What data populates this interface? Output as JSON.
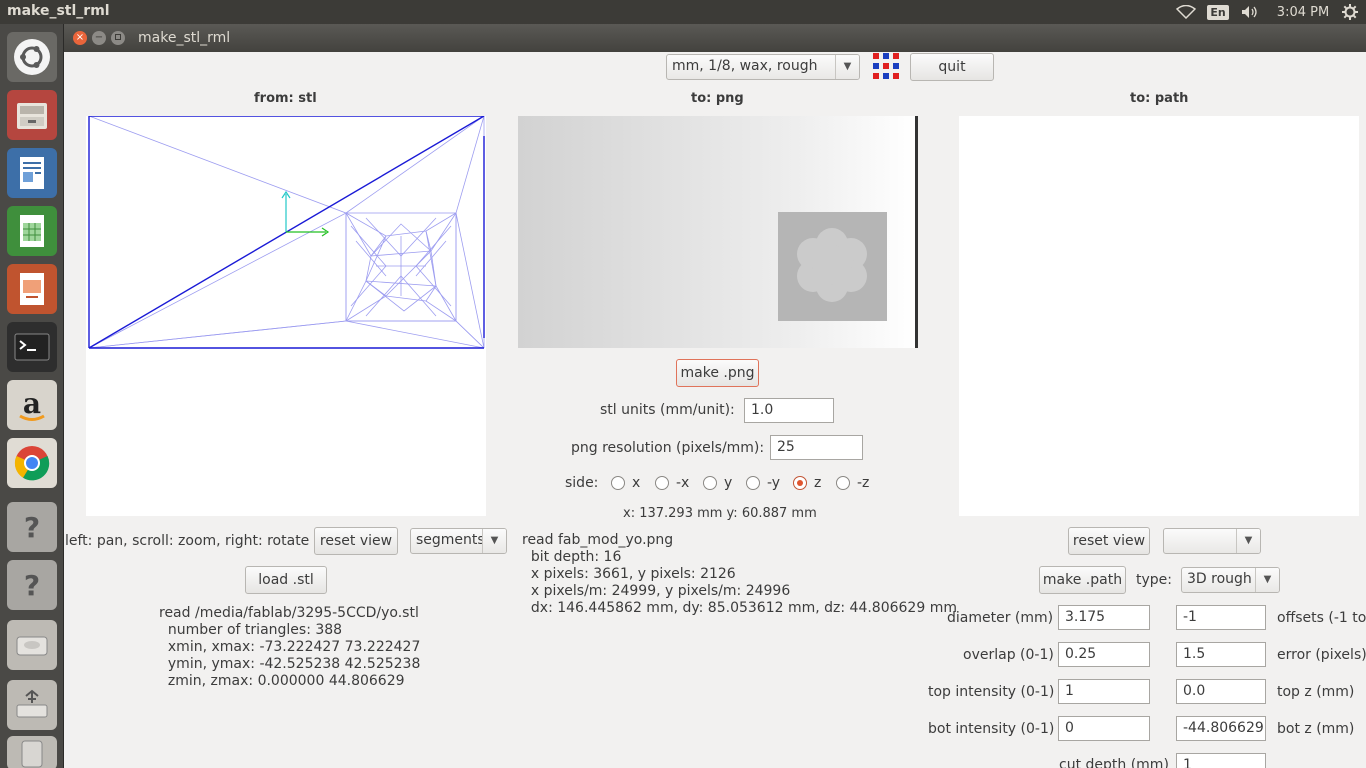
{
  "topbar": {
    "title": "make_stl_rml",
    "keyboard": "En",
    "clock": "3:04 PM"
  },
  "window": {
    "title": "make_stl_rml",
    "close_glyph": "×",
    "min_glyph": "−"
  },
  "toolbar": {
    "machine_select": "mm, 1/8, wax, rough",
    "quit_label": "quit"
  },
  "panels": {
    "from_stl": "from: stl",
    "to_png": "to: png",
    "to_path": "to: path"
  },
  "stl_section": {
    "hint": "left: pan, scroll: zoom, right: rotate",
    "reset_view_label": "reset view",
    "view_mode": "segments",
    "load_label": "load .stl",
    "info": {
      "line1": "read /media/fablab/3295-5CCD/yo.stl",
      "line2": "  number of triangles: 388",
      "line3": "  xmin, xmax: -73.222427 73.222427",
      "line4": "  ymin, ymax: -42.525238 42.525238",
      "line5": "  zmin, zmax: 0.000000 44.806629"
    }
  },
  "png_section": {
    "make_label": "make .png",
    "units_label": "stl units (mm/unit):",
    "units_value": "1.0",
    "resolution_label": "png resolution (pixels/mm):",
    "resolution_value": "25",
    "side_label": "side:",
    "sides": [
      "x",
      "-x",
      "y",
      "-y",
      "z",
      "-z"
    ],
    "selected_side": "z",
    "coords": "x: 137.293 mm  y: 60.887 mm",
    "info": {
      "line1": "read fab_mod_yo.png",
      "line2": "  bit depth: 16",
      "line3": "  x pixels: 3661, y pixels: 2126",
      "line4": "  x pixels/m: 24999, y pixels/m: 24996",
      "line5": "  dx: 146.445862 mm, dy: 85.053612 mm, dz: 44.806629 mm"
    }
  },
  "path_section": {
    "reset_view_label": "reset view",
    "view_mode": "",
    "make_label": "make .path",
    "type_label": "type:",
    "type_value": "3D rough",
    "diameter_label": "diameter (mm)",
    "diameter_value": "3.175",
    "offsets_value": "-1",
    "offsets_label": "offsets (-1 to",
    "overlap_label": "overlap (0-1)",
    "overlap_value": "0.25",
    "error_value": "1.5",
    "error_label": "error (pixels)",
    "top_intensity_label": "top intensity (0-1)",
    "top_intensity_value": "1",
    "top_z_value": "0.0",
    "top_z_label": "top z (mm)",
    "bot_intensity_label": "bot intensity (0-1)",
    "bot_intensity_value": "0",
    "bot_z_value": "-44.806629",
    "bot_z_label": "bot z (mm)",
    "cut_depth_label": "cut depth (mm)",
    "cut_depth_value": "1"
  }
}
